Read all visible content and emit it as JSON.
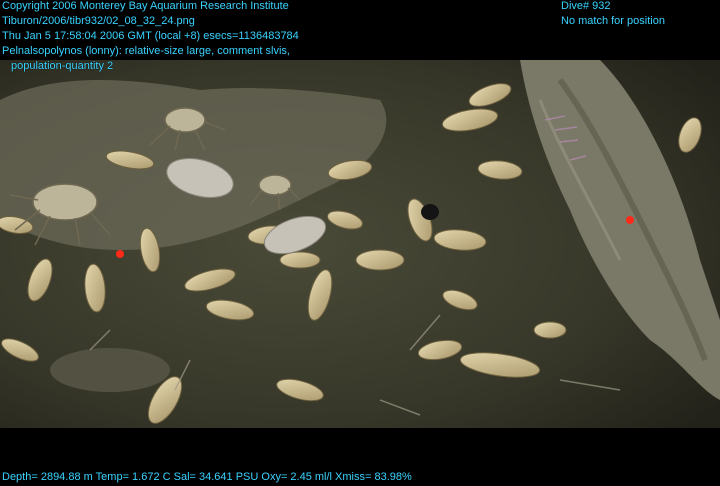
{
  "overlay": {
    "copyright": "Copyright 2006 Monterey Bay Aquarium Research Institute",
    "file_path": "Tiburon/2006/tibr932/02_08_32_24.png",
    "datetime": "Thu Jan  5 17:58:04 2006 GMT (local +8)  esecs=1136483784",
    "annotation_line1": "Pelnalsopolynos (lonny): relative-size large, comment slvis,",
    "annotation_line2": "population-quantity 2",
    "dive": "Dive# 932",
    "position_status": "No match for position",
    "telemetry": "Depth= 2894.88 m  Temp= 1.672 C  Sal= 34.641 PSU  Oxy= 2.45 ml/l  Xmiss= 83.98%"
  },
  "colors": {
    "overlay_text": "#39d3ff",
    "background": "#000000",
    "seafloor": "#3a3a2c",
    "laser_dot": "#ff2a1a"
  }
}
